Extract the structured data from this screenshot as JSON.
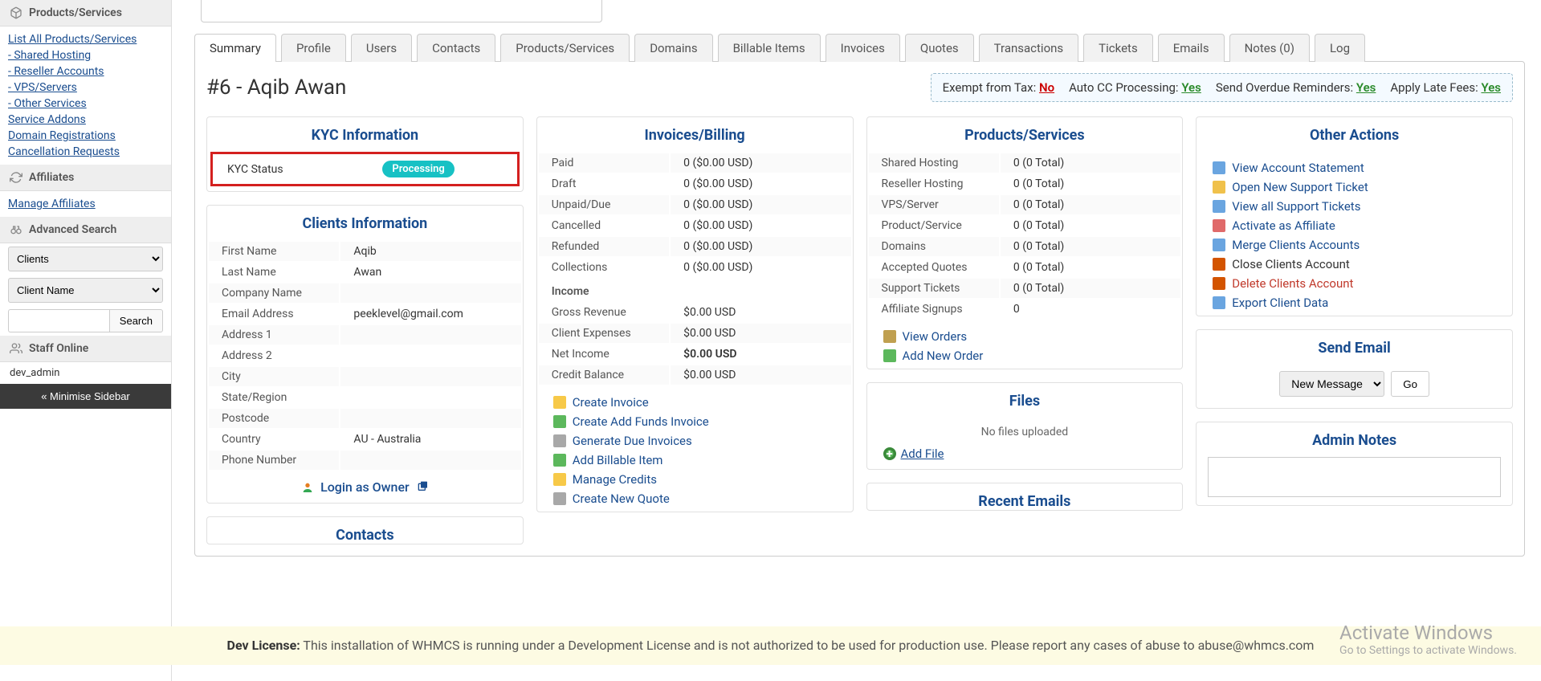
{
  "sidebar": {
    "products_services": {
      "title": "Products/Services",
      "links": [
        "List All Products/Services",
        "- Shared Hosting",
        "- Reseller Accounts",
        "- VPS/Servers",
        "- Other Services",
        "Service Addons",
        "Domain Registrations",
        "Cancellation Requests"
      ]
    },
    "affiliates": {
      "title": "Affiliates",
      "links": [
        "Manage Affiliates"
      ]
    },
    "advanced_search": {
      "title": "Advanced Search",
      "type_select": "Clients",
      "field_select": "Client Name",
      "search_btn": "Search"
    },
    "staff_online": {
      "title": "Staff Online",
      "user": "dev_admin"
    },
    "minimise": "« Minimise Sidebar"
  },
  "tabs": [
    "Summary",
    "Profile",
    "Users",
    "Contacts",
    "Products/Services",
    "Domains",
    "Billable Items",
    "Invoices",
    "Quotes",
    "Transactions",
    "Tickets",
    "Emails",
    "Notes (0)",
    "Log"
  ],
  "active_tab": "Summary",
  "client_header": "#6 - Aqib Awan",
  "settings_bar": {
    "exempt_tax": {
      "label": "Exempt from Tax:",
      "value": "No"
    },
    "autocc": {
      "label": "Auto CC Processing:",
      "value": "Yes"
    },
    "overdue": {
      "label": "Send Overdue Reminders:",
      "value": "Yes"
    },
    "latefees": {
      "label": "Apply Late Fees:",
      "value": "Yes"
    }
  },
  "kyc": {
    "title": "KYC Information",
    "status_label": "KYC Status",
    "status_value": "Processing"
  },
  "clients_info": {
    "title": "Clients Information",
    "rows": [
      {
        "k": "First Name",
        "v": "Aqib"
      },
      {
        "k": "Last Name",
        "v": "Awan"
      },
      {
        "k": "Company Name",
        "v": ""
      },
      {
        "k": "Email Address",
        "v": "peeklevel@gmail.com"
      },
      {
        "k": "Address 1",
        "v": ""
      },
      {
        "k": "Address 2",
        "v": ""
      },
      {
        "k": "City",
        "v": ""
      },
      {
        "k": "State/Region",
        "v": ""
      },
      {
        "k": "Postcode",
        "v": ""
      },
      {
        "k": "Country",
        "v": "AU - Australia"
      },
      {
        "k": "Phone Number",
        "v": ""
      }
    ],
    "login_owner": "Login as Owner"
  },
  "contacts_title": "Contacts",
  "invoices_billing": {
    "title": "Invoices/Billing",
    "rows": [
      {
        "k": "Paid",
        "v": "0 ($0.00 USD)"
      },
      {
        "k": "Draft",
        "v": "0 ($0.00 USD)"
      },
      {
        "k": "Unpaid/Due",
        "v": "0 ($0.00 USD)"
      },
      {
        "k": "Cancelled",
        "v": "0 ($0.00 USD)"
      },
      {
        "k": "Refunded",
        "v": "0 ($0.00 USD)"
      },
      {
        "k": "Collections",
        "v": "0 ($0.00 USD)"
      }
    ],
    "income_label": "Income",
    "income_rows": [
      {
        "k": "Gross Revenue",
        "v": "$0.00 USD"
      },
      {
        "k": "Client Expenses",
        "v": "$0.00 USD"
      },
      {
        "k": "Net Income",
        "v": "$0.00 USD",
        "bold": true
      },
      {
        "k": "Credit Balance",
        "v": "$0.00 USD"
      }
    ],
    "actions": [
      "Create Invoice",
      "Create Add Funds Invoice",
      "Generate Due Invoices",
      "Add Billable Item",
      "Manage Credits",
      "Create New Quote"
    ]
  },
  "products_services_panel": {
    "title": "Products/Services",
    "rows": [
      {
        "k": "Shared Hosting",
        "v": "0 (0 Total)"
      },
      {
        "k": "Reseller Hosting",
        "v": "0 (0 Total)"
      },
      {
        "k": "VPS/Server",
        "v": "0 (0 Total)"
      },
      {
        "k": "Product/Service",
        "v": "0 (0 Total)"
      },
      {
        "k": "Domains",
        "v": "0 (0 Total)"
      },
      {
        "k": "Accepted Quotes",
        "v": "0 (0 Total)"
      },
      {
        "k": "Support Tickets",
        "v": "0 (0 Total)"
      },
      {
        "k": "Affiliate Signups",
        "v": "0"
      }
    ],
    "actions": [
      "View Orders",
      "Add New Order"
    ]
  },
  "files": {
    "title": "Files",
    "no_files": "No files uploaded",
    "add_file": "Add File"
  },
  "recent_emails_title": "Recent Emails",
  "other_actions": {
    "title": "Other Actions",
    "links": [
      {
        "label": "View Account Statement",
        "color": "blue",
        "icon": "#6aa5e0"
      },
      {
        "label": "Open New Support Ticket",
        "color": "blue",
        "icon": "#f0c14b"
      },
      {
        "label": "View all Support Tickets",
        "color": "blue",
        "icon": "#6aa5e0"
      },
      {
        "label": "Activate as Affiliate",
        "color": "blue",
        "icon": "#e06a6a"
      },
      {
        "label": "Merge Clients Accounts",
        "color": "blue",
        "icon": "#6aa5e0"
      },
      {
        "label": "Close Clients Account",
        "color": "black",
        "icon": "#d35400"
      },
      {
        "label": "Delete Clients Account",
        "color": "red",
        "icon": "#d35400"
      },
      {
        "label": "Export Client Data",
        "color": "blue",
        "icon": "#6aa5e0"
      }
    ]
  },
  "send_email": {
    "title": "Send Email",
    "select": "New Message",
    "go": "Go"
  },
  "admin_notes": {
    "title": "Admin Notes"
  },
  "dev_license": {
    "bold": "Dev License:",
    "text": " This installation of WHMCS is running under a Development License and is not authorized to be used for production use. Please report any cases of abuse to abuse@whmcs.com"
  },
  "activate_windows": {
    "big": "Activate Windows",
    "small": "Go to Settings to activate Windows."
  }
}
